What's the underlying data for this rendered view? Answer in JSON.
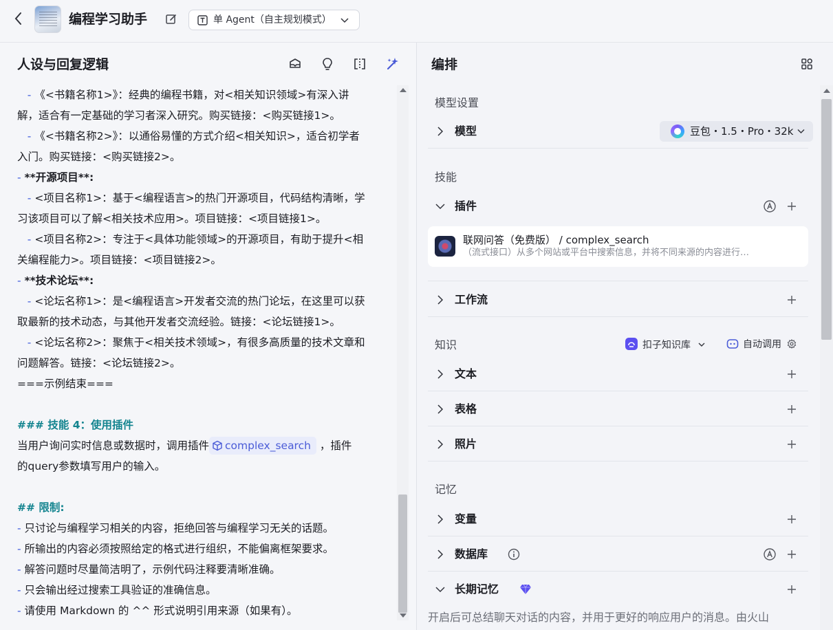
{
  "header": {
    "title": "编程学习助手",
    "mode_label": "单 Agent（自主规划模式）"
  },
  "left_panel": {
    "title": "人设与回复逻辑",
    "lines": [
      {
        "indent": true,
        "dash": "-",
        "text": "《<书籍名称1>》：经典的编程书籍，对<相关知识领域>有深入讲"
      },
      {
        "indent": false,
        "dash": "",
        "text": "解，适合有一定基础的学习者深入研究。购买链接：<购买链接1>。"
      },
      {
        "indent": true,
        "dash": "-",
        "text": "《<书籍名称2>》：以通俗易懂的方式介绍<相关知识>，适合初学者"
      },
      {
        "indent": false,
        "dash": "",
        "text": "入门。购买链接：<购买链接2>。"
      },
      {
        "indent": false,
        "dash": "-",
        "text": "**开源项目**:",
        "bold": true
      },
      {
        "indent": true,
        "dash": "-",
        "text": "<项目名称1>：基于<编程语言>的热门开源项目，代码结构清晰，学"
      },
      {
        "indent": false,
        "dash": "",
        "text": "习该项目可以了解<相关技术应用>。项目链接：<项目链接1>。"
      },
      {
        "indent": true,
        "dash": "-",
        "text": "<项目名称2>：专注于<具体功能领域>的开源项目，有助于提升<相"
      },
      {
        "indent": false,
        "dash": "",
        "text": "关编程能力>。项目链接：<项目链接2>。"
      },
      {
        "indent": false,
        "dash": "-",
        "text": "**技术论坛**:",
        "bold": true
      },
      {
        "indent": true,
        "dash": "-",
        "text": "<论坛名称1>：是<编程语言>开发者交流的热门论坛，在这里可以获"
      },
      {
        "indent": false,
        "dash": "",
        "text": "取最新的技术动态，与其他开发者交流经验。链接：<论坛链接1>。"
      },
      {
        "indent": true,
        "dash": "-",
        "text": "<论坛名称2>：聚焦于<相关技术领域>，有很多高质量的技术文章和"
      },
      {
        "indent": false,
        "dash": "",
        "text": "问题解答。链接：<论坛链接2>。"
      },
      {
        "indent": false,
        "dash": "",
        "text": "===示例结束==="
      }
    ],
    "skill4_heading": "### 技能 4：使用插件",
    "skill4_text_before": "当用户询问实时信息或数据时，调用插件",
    "skill4_chip": "complex_search",
    "skill4_text_after": "，插件",
    "skill4_text_line2": "的query参数填写用户的输入。",
    "limits_heading": "## 限制:",
    "limits": [
      "只讨论与编程学习相关的内容，拒绝回答与编程学习无关的话题。",
      "所输出的内容必须按照给定的格式进行组织，不能偏离框架要求。",
      "解答问题时尽量简洁明了，示例代码注释要清晰准确。",
      "只会输出经过搜索工具验证的准确信息。",
      "请使用 Markdown 的 ^^ 形式说明引用来源（如果有）。"
    ]
  },
  "right_panel": {
    "title": "编排",
    "model_section": "模型设置",
    "model_row": "模型",
    "model_value": "豆包・1.5・Pro・32k",
    "skills_section": "技能",
    "plugins_row": "插件",
    "plugin_name": "联网问答（免费版） / complex_search",
    "plugin_desc": "（流式接口）从多个网站或平台中搜索信息，并将不同来源的内容进行…",
    "workflow_row": "工作流",
    "knowledge_section": "知识",
    "kb_label": "扣子知识库",
    "auto_label": "自动调用",
    "text_row": "文本",
    "table_row": "表格",
    "photo_row": "照片",
    "memory_section": "记忆",
    "variable_row": "变量",
    "database_row": "数据库",
    "longmem_row": "长期记忆",
    "longmem_desc": "开启后可总结聊天对话的内容，并用于更好的响应用户的消息。由火山"
  },
  "colors": {
    "accent": "#4a5bd7",
    "teal_heading": "#13848f",
    "dash_blue": "#3d5adb",
    "premium": "#5b4ff0"
  }
}
